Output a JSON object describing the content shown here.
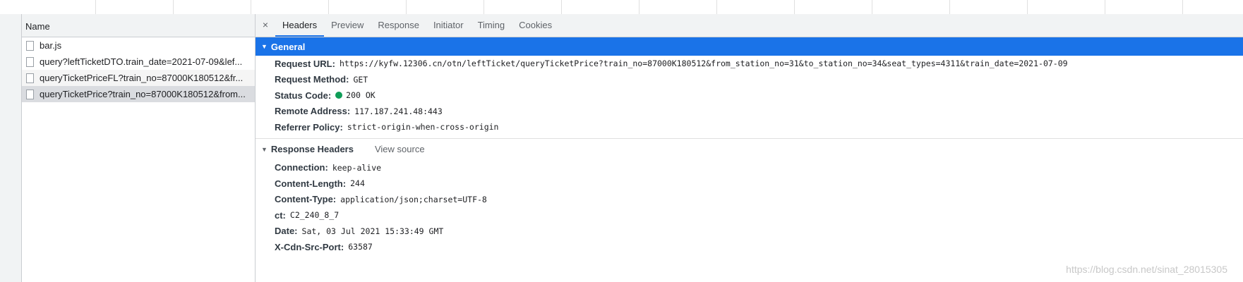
{
  "name_panel": {
    "header": "Name",
    "requests": [
      {
        "name": "bar.js"
      },
      {
        "name": "query?leftTicketDTO.train_date=2021-07-09&lef..."
      },
      {
        "name": "queryTicketPriceFL?train_no=87000K180512&fr..."
      },
      {
        "name": "queryTicketPrice?train_no=87000K180512&from..."
      }
    ]
  },
  "tabs": {
    "close": "×",
    "items": [
      "Headers",
      "Preview",
      "Response",
      "Initiator",
      "Timing",
      "Cookies"
    ],
    "active": "Headers"
  },
  "general": {
    "title": "General",
    "rows": [
      {
        "key": "Request URL:",
        "value": "https://kyfw.12306.cn/otn/leftTicket/queryTicketPrice?train_no=87000K180512&from_station_no=31&to_station_no=34&seat_types=4311&train_date=2021-07-09"
      },
      {
        "key": "Request Method:",
        "value": "GET"
      },
      {
        "key": "Status Code:",
        "value": "200 OK"
      },
      {
        "key": "Remote Address:",
        "value": "117.187.241.48:443"
      },
      {
        "key": "Referrer Policy:",
        "value": "strict-origin-when-cross-origin"
      }
    ]
  },
  "response_headers": {
    "title": "Response Headers",
    "view_source": "View source",
    "rows": [
      {
        "key": "Connection:",
        "value": "keep-alive"
      },
      {
        "key": "Content-Length:",
        "value": "244"
      },
      {
        "key": "Content-Type:",
        "value": "application/json;charset=UTF-8"
      },
      {
        "key": "ct:",
        "value": "C2_240_8_7"
      },
      {
        "key": "Date:",
        "value": "Sat, 03 Jul 2021 15:33:49 GMT"
      },
      {
        "key": "X-Cdn-Src-Port:",
        "value": "63587"
      }
    ]
  },
  "colors": {
    "accent": "#1a73e8",
    "status_ok": "#0f9d58"
  },
  "watermark": "https://blog.csdn.net/sinat_28015305"
}
